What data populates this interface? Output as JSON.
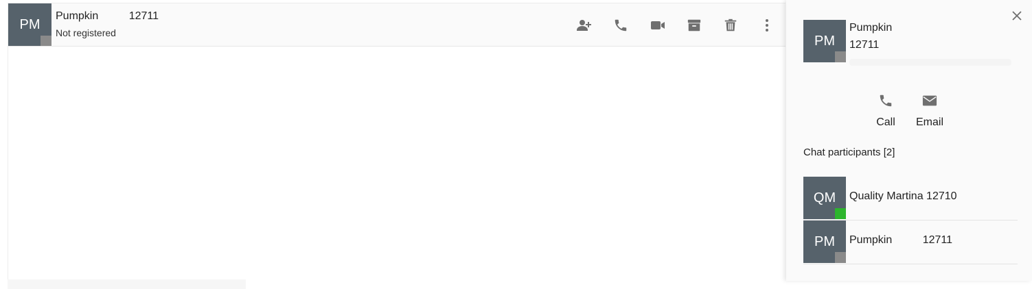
{
  "chat_header": {
    "avatar_initials": "PM",
    "name": "Pumpkin          12711",
    "subtitle": "Not registered",
    "status_color": "#8a8a8a",
    "toolbar": [
      {
        "icon": "add-person-icon"
      },
      {
        "icon": "phone-icon"
      },
      {
        "icon": "video-camera-icon"
      },
      {
        "icon": "archive-icon"
      },
      {
        "icon": "trash-icon"
      },
      {
        "icon": "more-vertical-icon"
      }
    ]
  },
  "info_panel": {
    "contact": {
      "avatar_initials": "PM",
      "name": "Pumpkin",
      "extension": "12711",
      "status_color": "#8a8a8a"
    },
    "actions": [
      {
        "label": "Call",
        "icon": "phone-icon"
      },
      {
        "label": "Email",
        "icon": "envelope-icon"
      }
    ],
    "participants_title": "Chat participants [2]",
    "participants": [
      {
        "initials": "QM",
        "name": "Quality Martina 12710",
        "status_color": "#2db52d"
      },
      {
        "initials": "PM",
        "name": "Pumpkin          12711",
        "status_color": "#8a8a8a"
      }
    ]
  },
  "colors": {
    "avatar_bg": "#56626b",
    "icon_gray": "#6f6f6f",
    "online_green": "#2db52d",
    "offline_gray": "#8a8a8a"
  }
}
